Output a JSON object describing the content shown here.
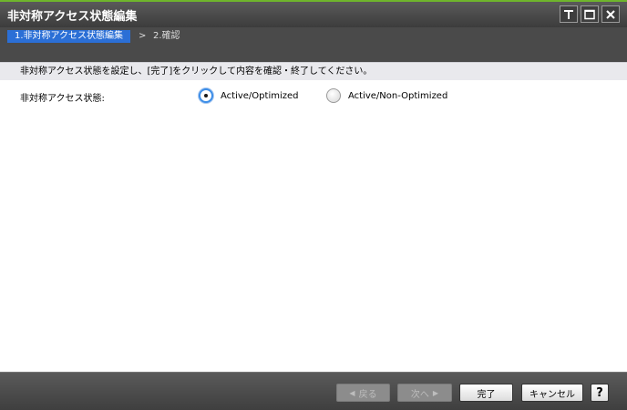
{
  "window": {
    "title": "非対称アクセス状態編集",
    "controls": [
      "pin-icon",
      "maximize-icon",
      "close-icon"
    ]
  },
  "steps": {
    "active": "1.非対称アクセス状態編集",
    "separator": ">",
    "next": "2.確認"
  },
  "instruction": "非対称アクセス状態を設定し、[完了]をクリックして内容を確認・終了してください。",
  "form": {
    "label": "非対称アクセス状態:",
    "options": [
      {
        "label": "Active/Optimized",
        "selected": true
      },
      {
        "label": "Active/Non-Optimized",
        "selected": false
      }
    ]
  },
  "footer": {
    "back": "戻る",
    "next": "次へ",
    "finish": "完了",
    "cancel": "キャンセル",
    "help": "?"
  },
  "colors": {
    "title_accent": "#6fb52c",
    "active_step": "#2b6fd6",
    "radio_selected": "#3d8ee8"
  }
}
